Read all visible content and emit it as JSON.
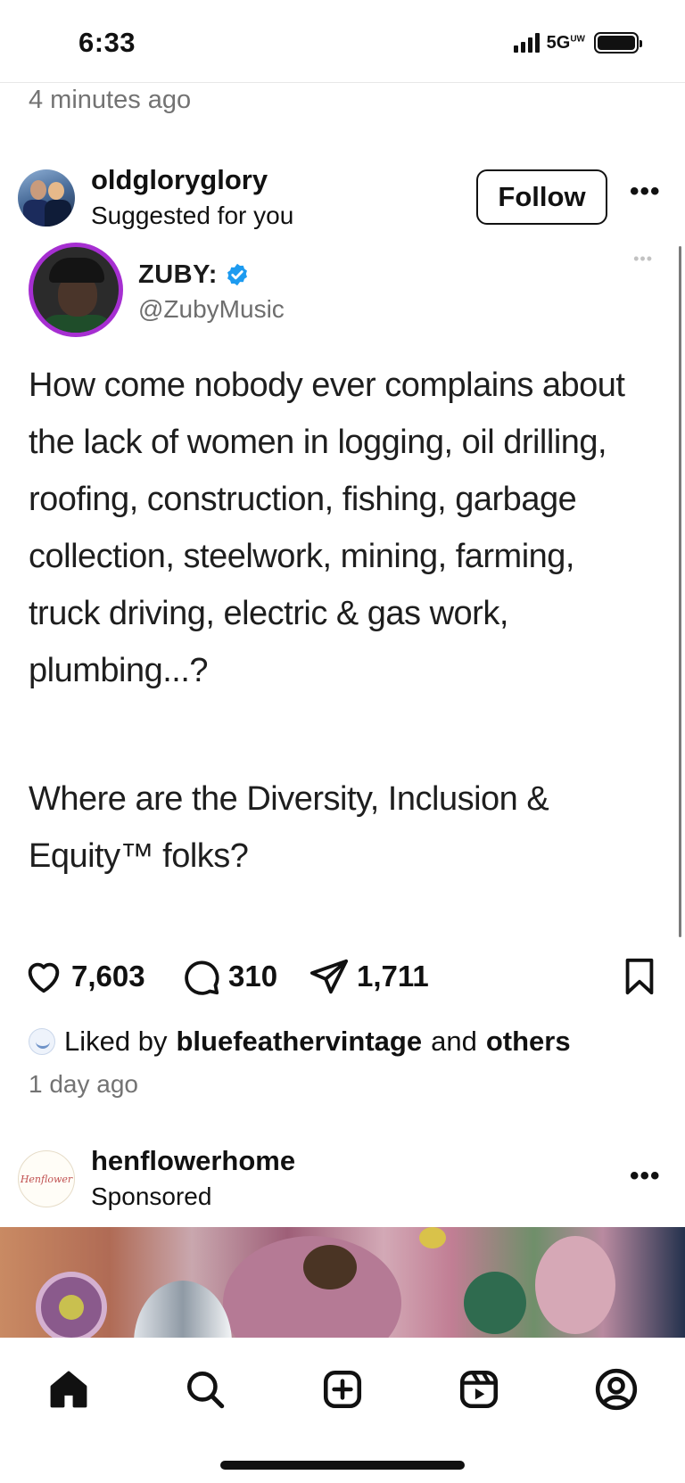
{
  "status_bar": {
    "time": "6:33",
    "network": "5G",
    "network_sup": "UW"
  },
  "previous_post": {
    "timestamp": "4 minutes ago"
  },
  "post": {
    "username": "oldgloryglory",
    "subtitle": "Suggested for you",
    "follow_label": "Follow",
    "more_label": "•••",
    "tweet": {
      "name": "ZUBY:",
      "handle": "@ZubyMusic",
      "more_label": "•••",
      "paragraph1": "How come nobody ever complains about the lack of women in logging, oil drilling, roofing, construction, fishing, garbage collection, steelwork, mining, farming, truck driving, electric & gas work, plumbing...?",
      "paragraph2": "Where are the Diversity, Inclusion & Equity™ folks?"
    },
    "likes": "7,603",
    "comments": "310",
    "shares": "1,711",
    "liked_by_prefix": "Liked by",
    "liked_by_user": "bluefeathervintage",
    "liked_by_and": "and",
    "liked_by_others": "others",
    "timestamp": "1 day ago"
  },
  "sponsored_post": {
    "username": "henflowerhome",
    "subtitle": "Sponsored",
    "more_label": "•••",
    "avatar_text": "Henflower"
  },
  "tabbar": {
    "items": [
      "home-icon",
      "search-icon",
      "create-icon",
      "reels-icon",
      "profile-icon"
    ]
  },
  "colors": {
    "verified": "#1d9bf0",
    "tweet_avatar_ring": "#a62fd1",
    "muted_text": "#737373"
  }
}
